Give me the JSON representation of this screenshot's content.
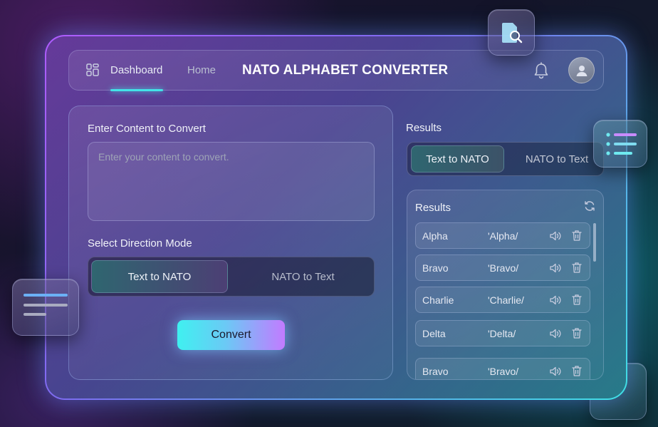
{
  "header": {
    "nav_dashboard": "Dashboard",
    "nav_home": "Home",
    "title": "NATO ALPHABET CONVERTER"
  },
  "input_panel": {
    "content_label": "Enter Content to Convert",
    "content_placeholder": "Enter your content to convert.",
    "direction_label": "Select Direction Mode",
    "mode_active": "Text to NATO",
    "mode_inactive": "NATO to Text",
    "convert_label": "Convert"
  },
  "results_panel": {
    "heading": "Results",
    "toggle_active": "Text to NATO",
    "toggle_inactive": "NATO to Text",
    "list_title": "Results",
    "rows": [
      {
        "word": "Alpha",
        "phonetic": "'Alpha/"
      },
      {
        "word": "Bravo",
        "phonetic": "'Bravo/"
      },
      {
        "word": "Charlie",
        "phonetic": "'Charlie/"
      },
      {
        "word": "Delta",
        "phonetic": "'Delta/"
      },
      {
        "word": "Bravo",
        "phonetic": "'Bravo/"
      }
    ]
  },
  "colors": {
    "accent_cyan": "#43e3e8",
    "accent_purple": "#b05cff"
  },
  "icons": {
    "nav": "grid-icon",
    "notifications": "bell-icon",
    "avatar": "user-icon",
    "refresh": "refresh-icon",
    "speak": "speaker-icon",
    "delete": "trash-icon",
    "floating_search": "document-search-icon",
    "floating_list": "list-icon"
  }
}
